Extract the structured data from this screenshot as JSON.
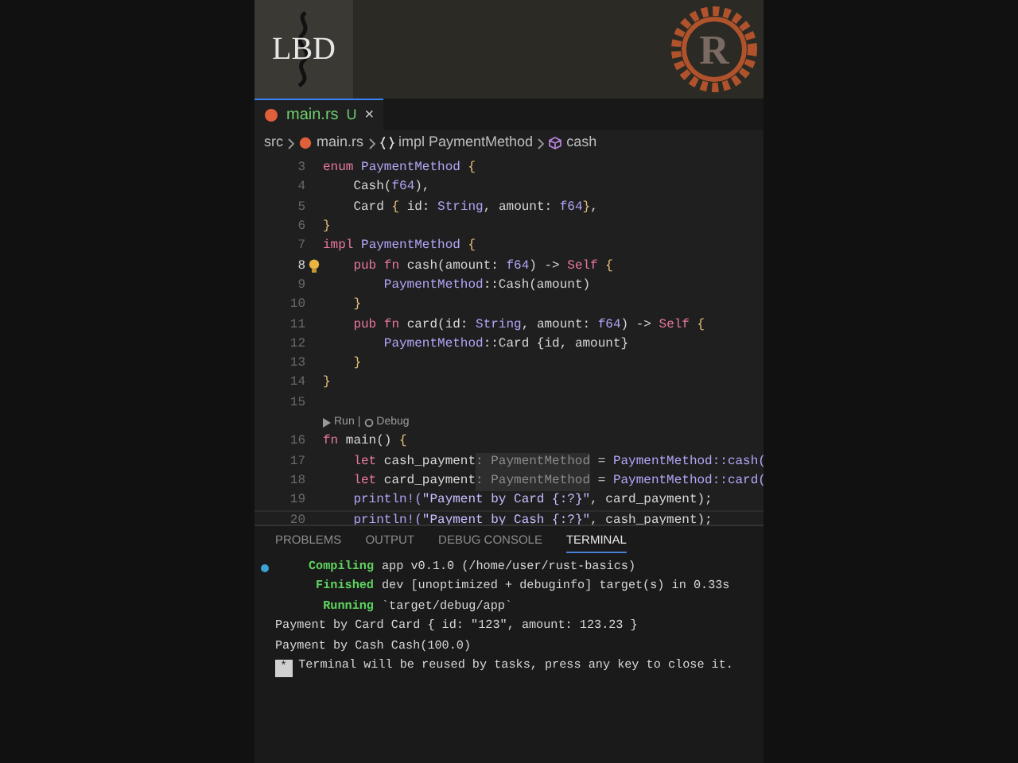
{
  "header": {
    "channel_logo": "LBD",
    "rust_logo_letter": "R"
  },
  "editor_tab": {
    "filename": "main.rs",
    "status": "U",
    "close": "×",
    "selected": true
  },
  "breadcrumb": [
    "src",
    "main.rs",
    "impl PaymentMethod",
    "cash"
  ],
  "code_lines": [
    {
      "kind": "code",
      "number": "3",
      "active": false,
      "segments": [
        {
          "kind": "keyword",
          "text": "enum "
        },
        {
          "kind": "type",
          "text": "PaymentMethod "
        },
        {
          "kind": "brace",
          "text": "{"
        }
      ]
    },
    {
      "kind": "code",
      "number": "4",
      "active": false,
      "segments": [
        {
          "kind": "plain",
          "text": "    Cash("
        },
        {
          "kind": "type",
          "text": "f64"
        },
        {
          "kind": "plain",
          "text": "),"
        }
      ]
    },
    {
      "kind": "code",
      "number": "5",
      "active": false,
      "segments": [
        {
          "kind": "plain",
          "text": "    Card "
        },
        {
          "kind": "brace",
          "text": "{"
        },
        {
          "kind": "plain",
          "text": " id: "
        },
        {
          "kind": "type",
          "text": "String"
        },
        {
          "kind": "plain",
          "text": ", amount: "
        },
        {
          "kind": "type",
          "text": "f64"
        },
        {
          "kind": "brace",
          "text": "}"
        },
        {
          "kind": "plain",
          "text": ","
        }
      ]
    },
    {
      "kind": "code",
      "number": "6",
      "active": false,
      "segments": [
        {
          "kind": "brace",
          "text": "}"
        }
      ]
    },
    {
      "kind": "code",
      "number": "7",
      "active": false,
      "segments": [
        {
          "kind": "keyword",
          "text": "impl "
        },
        {
          "kind": "type",
          "text": "PaymentMethod "
        },
        {
          "kind": "brace",
          "text": "{"
        }
      ]
    },
    {
      "kind": "code",
      "number": "8",
      "active": true,
      "segments": [
        {
          "kind": "keyword",
          "text": "    pub fn "
        },
        {
          "kind": "plain",
          "text": "cash(amount: "
        },
        {
          "kind": "type",
          "text": "f64"
        },
        {
          "kind": "plain",
          "text": ") -> "
        },
        {
          "kind": "keyword",
          "text": "Self "
        },
        {
          "kind": "brace",
          "text": "{"
        }
      ]
    },
    {
      "kind": "code",
      "number": "9",
      "active": false,
      "segments": [
        {
          "kind": "type",
          "text": "        PaymentMethod"
        },
        {
          "kind": "plain",
          "text": "::Cash(amount)"
        }
      ]
    },
    {
      "kind": "code",
      "number": "10",
      "active": false,
      "segments": [
        {
          "kind": "brace",
          "text": "    }"
        }
      ]
    },
    {
      "kind": "code",
      "number": "11",
      "active": false,
      "segments": [
        {
          "kind": "keyword",
          "text": "    pub fn "
        },
        {
          "kind": "plain",
          "text": "card(id: "
        },
        {
          "kind": "type",
          "text": "String"
        },
        {
          "kind": "plain",
          "text": ", amount: "
        },
        {
          "kind": "type",
          "text": "f64"
        },
        {
          "kind": "plain",
          "text": ") -> "
        },
        {
          "kind": "keyword",
          "text": "Self "
        },
        {
          "kind": "brace",
          "text": "{"
        }
      ]
    },
    {
      "kind": "code",
      "number": "12",
      "active": false,
      "segments": [
        {
          "kind": "type",
          "text": "        PaymentMethod"
        },
        {
          "kind": "plain",
          "text": "::Card {id, amount}"
        }
      ]
    },
    {
      "kind": "code",
      "number": "13",
      "active": false,
      "segments": [
        {
          "kind": "brace",
          "text": "    }"
        }
      ]
    },
    {
      "kind": "code",
      "number": "14",
      "active": false,
      "segments": [
        {
          "kind": "brace",
          "text": "}"
        }
      ]
    },
    {
      "kind": "code",
      "number": "15",
      "active": false
    },
    {
      "kind": "codelens",
      "run": "Run",
      "separator": "|",
      "debug": "Debug"
    },
    {
      "kind": "code",
      "number": "16",
      "active": false,
      "segments": [
        {
          "kind": "keyword",
          "text": "fn "
        },
        {
          "kind": "plain",
          "text": "main() "
        },
        {
          "kind": "brace",
          "text": "{"
        }
      ]
    },
    {
      "kind": "code",
      "number": "17",
      "active": false,
      "segments": [
        {
          "kind": "keyword",
          "text": "    let "
        },
        {
          "kind": "plain",
          "text": "cash_payment"
        },
        {
          "kind": "hint",
          "text": ": PaymentMethod"
        },
        {
          "kind": "plain",
          "text": " = "
        },
        {
          "kind": "type",
          "text": "PaymentMethod::cash("
        }
      ]
    },
    {
      "kind": "code",
      "number": "18",
      "active": false,
      "segments": [
        {
          "kind": "keyword",
          "text": "    let "
        },
        {
          "kind": "plain",
          "text": "card_payment"
        },
        {
          "kind": "hint",
          "text": ": PaymentMethod"
        },
        {
          "kind": "plain",
          "text": " = "
        },
        {
          "kind": "type",
          "text": "PaymentMethod::card("
        }
      ]
    },
    {
      "kind": "code",
      "number": "19",
      "active": false,
      "segments": [
        {
          "kind": "type",
          "text": "    println!("
        },
        {
          "kind": "string",
          "text": "\"Payment by Card {:?}\""
        },
        {
          "kind": "plain",
          "text": ", card_payment);"
        }
      ]
    },
    {
      "kind": "code",
      "number": "20",
      "active": false,
      "segments": [
        {
          "kind": "type",
          "text": "    println!("
        },
        {
          "kind": "string",
          "text": "\"Payment by Cash {:?}\""
        },
        {
          "kind": "plain",
          "text": ", cash_payment);"
        }
      ]
    }
  ],
  "panel_tabs": [
    {
      "label": "PROBLEMS",
      "selected": false
    },
    {
      "label": "OUTPUT",
      "selected": false
    },
    {
      "label": "DEBUG CONSOLE",
      "selected": false
    },
    {
      "label": "TERMINAL",
      "selected": true
    }
  ],
  "terminal_lines": [
    {
      "kind": "status",
      "dot": true,
      "label": "Compiling",
      "text": "app v0.1.0 (/home/user/rust-basics)"
    },
    {
      "kind": "status",
      "label": "Finished",
      "text": "dev [unoptimized + debuginfo] target(s) in 0.33s"
    },
    {
      "kind": "status",
      "label": "Running",
      "text": "`target/debug/app`"
    },
    {
      "kind": "output",
      "text": "Payment by Card Card { id: \"123\", amount: 123.23 }"
    },
    {
      "kind": "output",
      "text": "Payment by Cash Cash(100.0)"
    },
    {
      "kind": "notice",
      "marker": "*",
      "text": "Terminal will be reused by tasks, press any key to close it."
    }
  ]
}
